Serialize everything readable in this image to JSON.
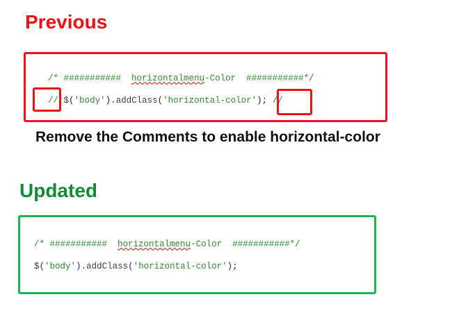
{
  "previous": {
    "heading": "Previous",
    "line1": {
      "prefix": "/* ###########  ",
      "word": "horizontalmenu",
      "suffix": "-Color  ###########*/"
    },
    "line2": {
      "lead": "//",
      "space": " ",
      "dollar": "$",
      "open": "(",
      "string": "'body'",
      "close": ")",
      "method": ".addClass",
      "arg_open": "(",
      "arg": "'horizontal-color'",
      "arg_close": ")",
      "semicolon": ";",
      "trail": " //"
    }
  },
  "instruction": "Remove the Comments to enable horizontal-color",
  "updated": {
    "heading": "Updated",
    "line1": {
      "prefix": "/* ###########  ",
      "word": "horizontalmenu",
      "suffix": "-Color  ###########*/"
    },
    "line2": {
      "dollar": "$",
      "open": "(",
      "string": "'body'",
      "close": ")",
      "method": ".addClass",
      "arg_open": "(",
      "arg": "'horizontal-color'",
      "arg_close": ")",
      "semicolon": ";"
    }
  },
  "colors": {
    "previous_heading": "#ee1111",
    "updated_heading": "#128a36",
    "previous_border": "#ee1122",
    "updated_border": "#1fb450",
    "code_comment": "#2e8b2e"
  }
}
